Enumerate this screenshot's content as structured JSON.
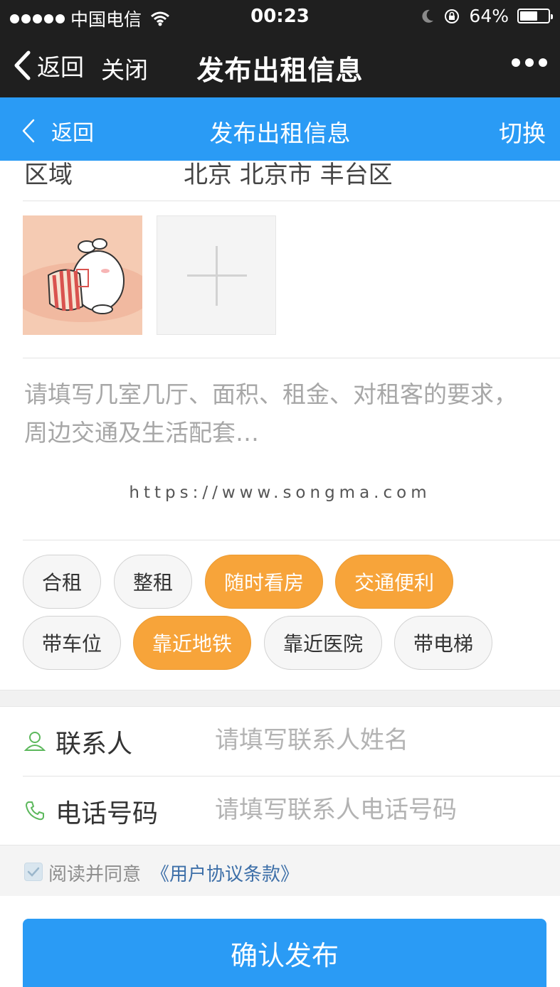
{
  "status_bar": {
    "carrier": "中国电信",
    "time": "00:23",
    "battery": "64%",
    "battery_level": 0.64
  },
  "wechat_nav": {
    "back_label": "返回",
    "close_label": "关闭",
    "title": "发布出租信息"
  },
  "app_header": {
    "back_label": "返回",
    "title": "发布出租信息",
    "switch_label": "切换"
  },
  "region": {
    "label": "区域",
    "value": "北京 北京市 丰台区"
  },
  "description": {
    "placeholder": "请填写几室几厅、面积、租金、对租客的要求，周边交通及生活配套…"
  },
  "watermark": "https://www.songma.com",
  "tags": [
    {
      "label": "合租",
      "selected": false
    },
    {
      "label": "整租",
      "selected": false
    },
    {
      "label": "随时看房",
      "selected": true
    },
    {
      "label": "交通便利",
      "selected": true
    },
    {
      "label": "带车位",
      "selected": false
    },
    {
      "label": "靠近地铁",
      "selected": true
    },
    {
      "label": "靠近医院",
      "selected": false
    },
    {
      "label": "带电梯",
      "selected": false
    }
  ],
  "contact": {
    "label": "联系人",
    "placeholder": "请填写联系人姓名"
  },
  "phone": {
    "label": "电话号码",
    "placeholder": "请填写联系人电话号码"
  },
  "agreement": {
    "text": "阅读并同意",
    "link": "《用户协议条款》",
    "checked": true
  },
  "submit_label": "确认发布",
  "colors": {
    "primary_blue": "#2a9bf5",
    "tag_active_orange": "#f7a43a",
    "dark_bar": "#1f1f1f",
    "icon_green": "#5cb85c"
  }
}
